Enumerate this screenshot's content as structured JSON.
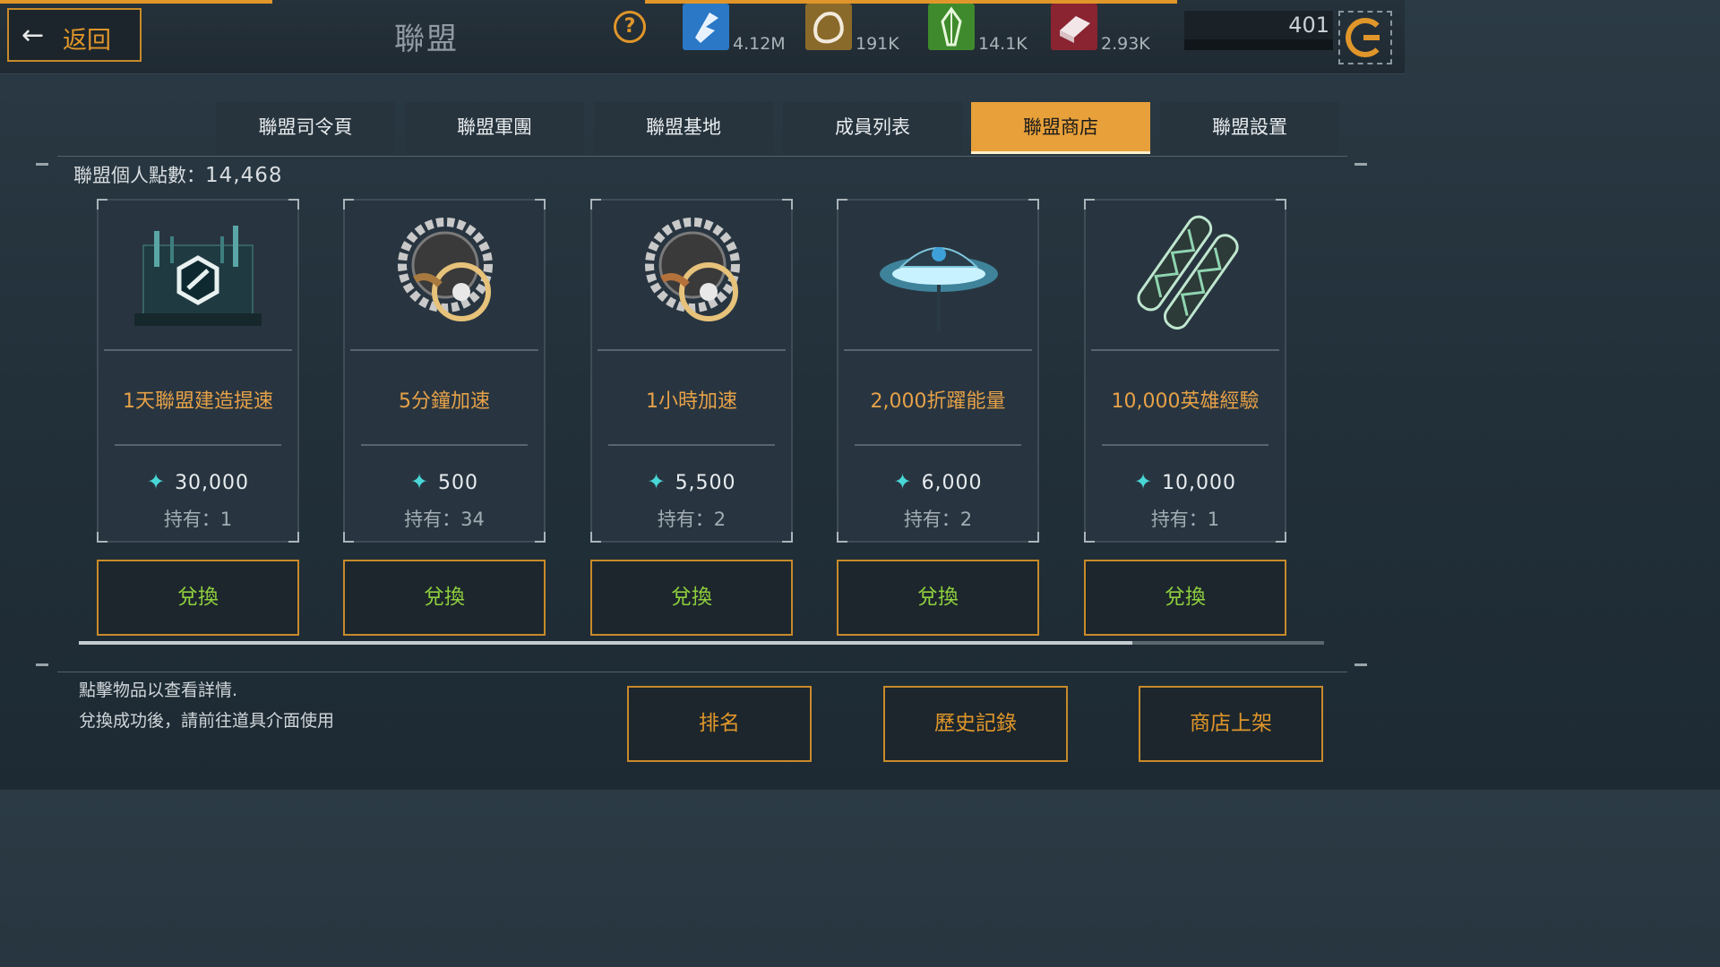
{
  "header": {
    "back_label": "返回",
    "title": "聯盟",
    "resources": [
      {
        "icon": "energy-crystal-icon",
        "value": "4.12M",
        "color": "#2a78c6"
      },
      {
        "icon": "ore-icon",
        "value": "191K",
        "color": "#8a6a2a"
      },
      {
        "icon": "green-crystal-icon",
        "value": "14.1K",
        "color": "#3f8a2c"
      },
      {
        "icon": "alloy-icon",
        "value": "2.93K",
        "color": "#8a2430"
      }
    ],
    "power_value": "401"
  },
  "tabs": [
    {
      "label": "聯盟司令頁",
      "active": false
    },
    {
      "label": "聯盟軍團",
      "active": false
    },
    {
      "label": "聯盟基地",
      "active": false
    },
    {
      "label": "成員列表",
      "active": false
    },
    {
      "label": "聯盟商店",
      "active": true
    },
    {
      "label": "聯盟設置",
      "active": false
    }
  ],
  "points": {
    "label": "聯盟個人點數：",
    "value": "14,468"
  },
  "items": [
    {
      "name": "1天聯盟建造提速",
      "price": "30,000",
      "owned": "持有：1",
      "icon": "alliance-build-speedup-icon"
    },
    {
      "name": "5分鐘加速",
      "price": "500",
      "owned": "持有：34",
      "icon": "speedup-gear-icon"
    },
    {
      "name": "1小時加速",
      "price": "5,500",
      "owned": "持有：2",
      "icon": "speedup-gear-icon"
    },
    {
      "name": "2,000折躍能量",
      "price": "6,000",
      "owned": "持有：2",
      "icon": "warp-energy-device-icon"
    },
    {
      "name": "10,000英雄經驗",
      "price": "10,000",
      "owned": "持有：1",
      "icon": "hero-exp-tube-icon"
    }
  ],
  "exchange_label": "兌換",
  "footer": {
    "hint_line1": "點擊物品以查看詳情.",
    "hint_line2": "兌換成功後，請前往道具介面使用",
    "buttons": [
      "排名",
      "歷史記錄",
      "商店上架"
    ]
  },
  "colors": {
    "accent": "#e0962a",
    "exchange_text": "#8fcf3e",
    "gem": "#49d6d6"
  }
}
